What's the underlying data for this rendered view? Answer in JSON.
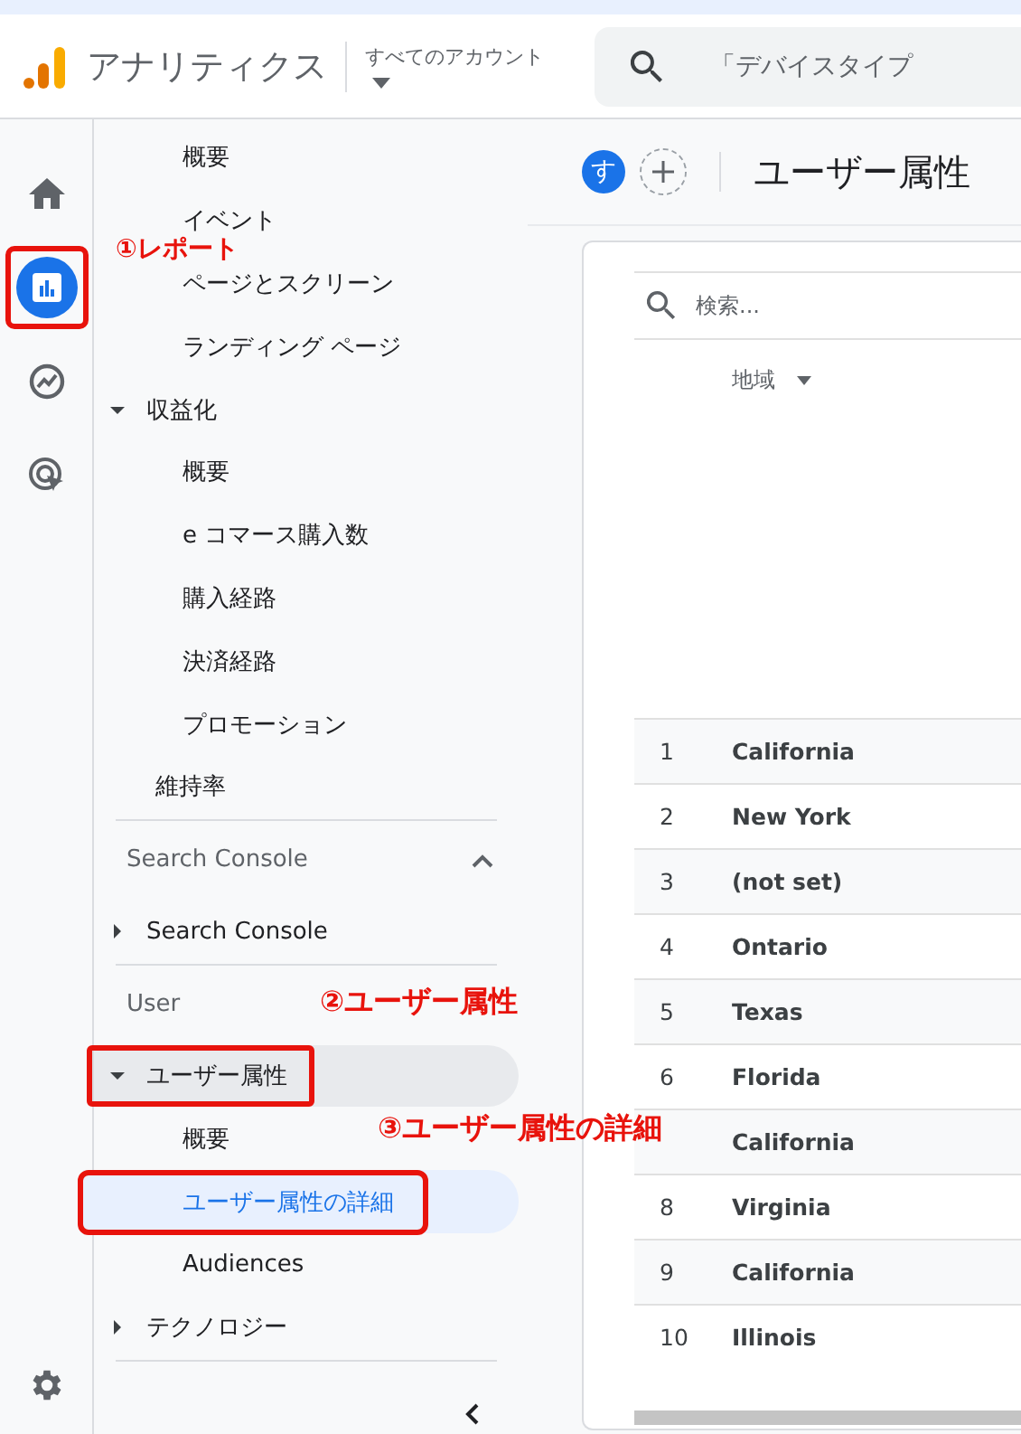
{
  "header": {
    "product_name": "アナリティクス",
    "account_picker": "すべてのアカウント",
    "search": {
      "placeholder": "「デバイスタイプ"
    }
  },
  "rail": [
    {
      "kind": "home",
      "selected": false,
      "annotated": false
    },
    {
      "kind": "reports",
      "selected": true,
      "annotated": true
    },
    {
      "kind": "explore",
      "selected": false,
      "annotated": false
    },
    {
      "kind": "advertising",
      "selected": false,
      "annotated": false
    }
  ],
  "nav": [
    {
      "kind": "item",
      "label": "概要",
      "selected": false,
      "annotated": false
    },
    {
      "kind": "item",
      "label": "イベント",
      "selected": false,
      "annotated": false
    },
    {
      "kind": "item",
      "label": "ページとスクリーン",
      "selected": false,
      "annotated": false
    },
    {
      "kind": "item",
      "label": "ランディング ページ",
      "selected": false,
      "annotated": false
    },
    {
      "kind": "group",
      "label": "収益化",
      "expanded": true,
      "annotated": false,
      "children": [
        {
          "label": "概要",
          "selected": false,
          "annotated": false
        },
        {
          "label": "e コマース購入数",
          "selected": false,
          "annotated": false
        },
        {
          "label": "購入経路",
          "selected": false,
          "annotated": false
        },
        {
          "label": "決済経路",
          "selected": false,
          "annotated": false
        },
        {
          "label": "プロモーション",
          "selected": false,
          "annotated": false
        }
      ]
    },
    {
      "kind": "leaf",
      "label": "維持率",
      "annotated": false
    },
    {
      "kind": "divider"
    },
    {
      "kind": "section",
      "label": "Search Console",
      "expanded": true
    },
    {
      "kind": "group",
      "label": "Search Console",
      "expanded": false,
      "annotated": false
    },
    {
      "kind": "divider"
    },
    {
      "kind": "section",
      "label": "User"
    },
    {
      "kind": "group",
      "label": "ユーザー属性",
      "expanded": true,
      "annotated": true,
      "children": [
        {
          "label": "概要",
          "selected": false,
          "annotated": false
        },
        {
          "label": "ユーザー属性の詳細",
          "selected": true,
          "annotated": true
        },
        {
          "label": "Audiences",
          "selected": false,
          "annotated": false
        }
      ]
    },
    {
      "kind": "group",
      "label": "テクノロジー",
      "expanded": false,
      "annotated": false
    },
    {
      "kind": "divider"
    }
  ],
  "toolbar": {
    "avatar_letter": "す",
    "page_title": "ユーザー属性"
  },
  "table": {
    "search": {
      "placeholder": "検索..."
    },
    "columns": [
      "地域"
    ],
    "rows": [
      {
        "rank": "1",
        "region": "California"
      },
      {
        "rank": "2",
        "region": "New York"
      },
      {
        "rank": "3",
        "region": "(not set)"
      },
      {
        "rank": "4",
        "region": "Ontario"
      },
      {
        "rank": "5",
        "region": "Texas"
      },
      {
        "rank": "6",
        "region": "Florida"
      },
      {
        "region": "California"
      },
      {
        "rank": "8",
        "region": "Virginia"
      },
      {
        "rank": "9",
        "region": "California"
      },
      {
        "rank": "10",
        "region": "Illinois"
      }
    ]
  },
  "annotations": [
    "①レポート",
    "②ユーザー属性",
    "③ユーザー属性の詳細"
  ]
}
